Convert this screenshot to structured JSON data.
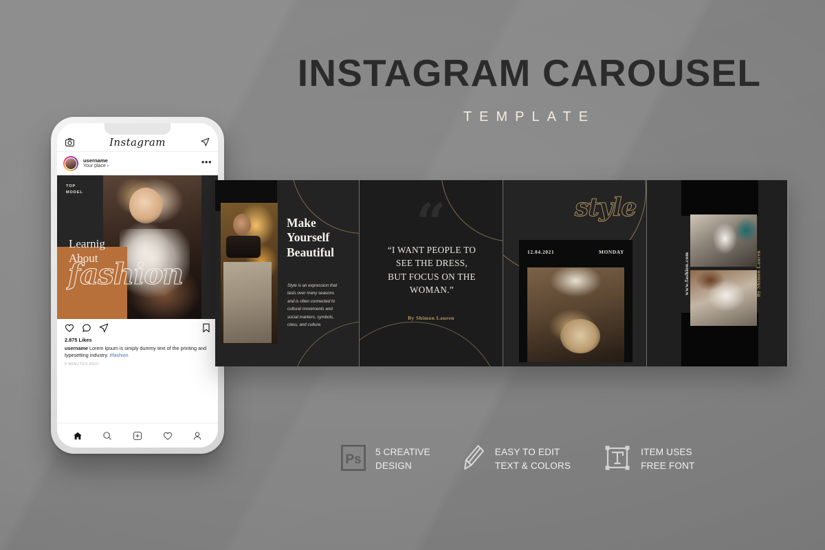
{
  "header": {
    "title": "INSTAGRAM CAROUSEL",
    "subtitle": "TEMPLATE"
  },
  "colors": {
    "background": "#838383",
    "title": "#2b2b2b",
    "subtitle": "#f2ece1",
    "panel_dark": "#1f1f1f",
    "accent_gold": "#b59a63",
    "accent_orange": "#b8703a"
  },
  "phone": {
    "topbar": {
      "camera_icon": "camera-icon",
      "logo": "Instagram",
      "send_icon": "paper-plane-icon"
    },
    "post_header": {
      "username": "username",
      "location": "Your place",
      "location_chevron": "›",
      "more_icon": "•••"
    },
    "post_image": {
      "top_label_line1": "TOP",
      "top_label_line2": "MODEL",
      "heading_line1": "Learnig",
      "heading_line2": "About",
      "script_word": "fashion"
    },
    "actions": {
      "like_icon": "heart-icon",
      "comment_icon": "comment-icon",
      "share_icon": "paper-plane-icon",
      "bookmark_icon": "bookmark-icon"
    },
    "caption": {
      "likes": "2.875 Likes",
      "author": "username",
      "text": " Lorem Ipsum is simply dummy text of the printing and typesetting industry. ",
      "hashtag": "#fashion",
      "timestamp": "8 MINUTES AGO"
    },
    "bottom_nav": [
      {
        "name": "home-icon",
        "label": "Home"
      },
      {
        "name": "search-icon",
        "label": "Search"
      },
      {
        "name": "add-post-icon",
        "label": "Add"
      },
      {
        "name": "activity-heart-icon",
        "label": "Activity"
      },
      {
        "name": "profile-icon",
        "label": "Profile"
      }
    ]
  },
  "carousel": {
    "panel1": {
      "heading_line1": "Make",
      "heading_line2": "Yourself",
      "heading_line3": "Beautiful",
      "body": "Style is an expression that lasts over many seasons and is often connected to cultural movements and social markers, symbols, class, and culture."
    },
    "panel2": {
      "quote_mark": "“",
      "quote_line1": "“I WANT PEOPLE TO",
      "quote_line2": "SEE THE DRESS,",
      "quote_line3": "BUT FOCUS ON THE",
      "quote_line4": "WOMAN.”",
      "author": "By Shimon Lauren"
    },
    "panel3": {
      "script_word": "style",
      "date": "12.04.2021",
      "day": "MONDAY"
    },
    "panel4": {
      "website": "www.fashion.com",
      "author": "By Shimon Lauren"
    }
  },
  "features": [
    {
      "icon": "photoshop-icon",
      "line1": "5 CREATIVE",
      "line2": "DESIGN"
    },
    {
      "icon": "pencil-icon",
      "line1": "EASY TO EDIT",
      "line2": "TEXT & COLORS"
    },
    {
      "icon": "free-font-icon",
      "line1": "ITEM USES",
      "line2": "FREE FONT"
    }
  ]
}
